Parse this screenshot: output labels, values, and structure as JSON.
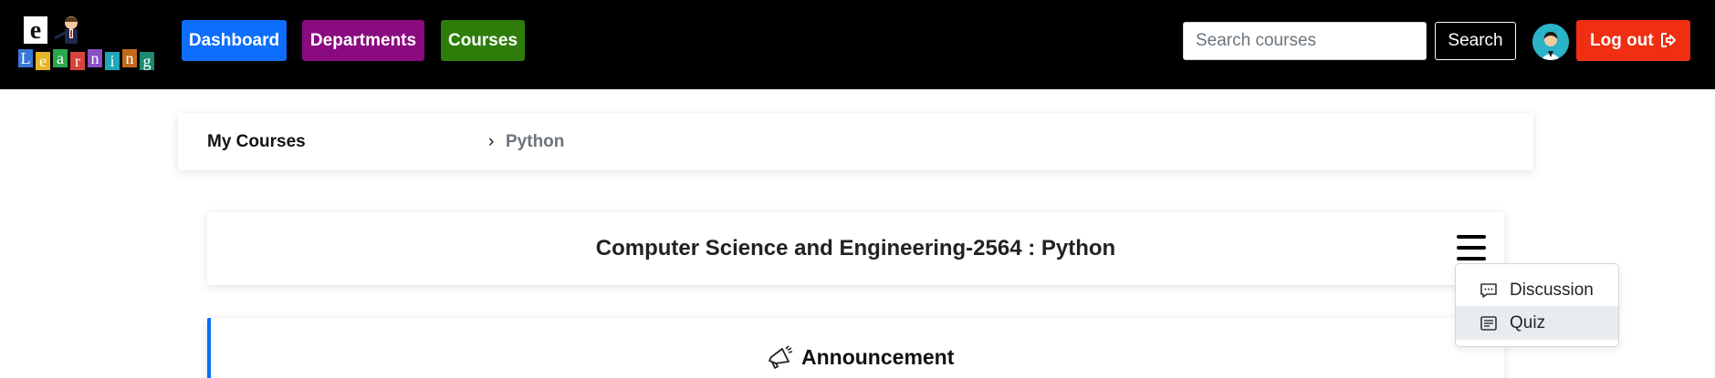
{
  "logo": {
    "top_letter": "e",
    "word_letters": [
      "L",
      "e",
      "a",
      "r",
      "n",
      "i",
      "n",
      "g"
    ],
    "tile_colors": [
      "#3a76d8",
      "#e6b527",
      "#2aa84a",
      "#d6453d",
      "#8b4fc4",
      "#1fa6b8",
      "#c26a1b",
      "#1f8a70"
    ]
  },
  "nav": {
    "dashboard_label": "Dashboard",
    "departments_label": "Departments",
    "courses_label": "Courses",
    "search_placeholder": "Search courses",
    "search_button_label": "Search",
    "logout_label": "Log out"
  },
  "breadcrumb": {
    "home": "My Courses",
    "separator": "›",
    "current": "Python"
  },
  "course": {
    "title": "Computer Science and Engineering-2564 : Python"
  },
  "dropdown": {
    "items": [
      {
        "label": "Discussion",
        "icon": "chat-icon"
      },
      {
        "label": "Quiz",
        "icon": "document-icon"
      }
    ]
  },
  "announcement": {
    "title": "Announcement",
    "icon": "megaphone-icon"
  },
  "colors": {
    "navbar_bg": "#000000",
    "dashboard": "#0d6efd",
    "departments": "#8a0a7f",
    "courses": "#2e7d0b",
    "logout": "#ef2e12",
    "accent_border": "#0d6efd"
  }
}
